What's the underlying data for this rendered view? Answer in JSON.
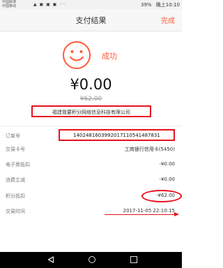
{
  "status_bar": {
    "carrier1": "中国联通",
    "carrier2": "中国移动",
    "icons": "▲ ▣ ▣ ▣ ···",
    "battery": "39%",
    "time": "晚上10:10"
  },
  "header": {
    "title": "支付结果",
    "done_label": "完成"
  },
  "result": {
    "status_text": "成功",
    "amount": "¥0.00",
    "original_amount": "¥62.00",
    "merchant": "福建我要积分网络信息科技有限公司"
  },
  "details": [
    {
      "label": "订单号",
      "value": "1402481603992017110541487831"
    },
    {
      "label": "交易卡号",
      "value": "工商银行信用卡(5450)"
    },
    {
      "label": "电子券抵扣",
      "value": "-¥0.00"
    },
    {
      "label": "消费立减",
      "value": "-¥0.00"
    },
    {
      "label": "积分抵扣",
      "value": "-¥62.00"
    },
    {
      "label": "交易时间",
      "value": "2017-11-05 22:10:15"
    }
  ],
  "colors": {
    "accent": "#ff5a36",
    "annotation_red": "#e8101e"
  },
  "icons": {
    "smile": "smiley-face-icon",
    "back": "back-triangle-icon",
    "home": "home-circle-icon",
    "recent": "recent-square-icon"
  }
}
